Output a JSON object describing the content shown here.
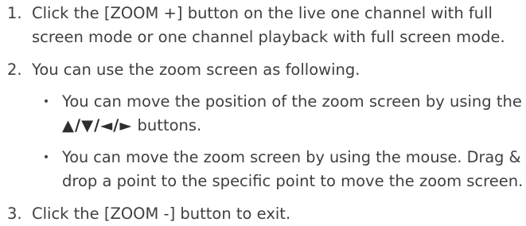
{
  "steps": [
    {
      "number": "1.",
      "lines": [
        "Click the [ZOOM +] button on the live one channel with full",
        "screen mode or one channel playback with full screen mode."
      ]
    },
    {
      "number": "2.",
      "lines": [
        "You can use the zoom screen as following."
      ],
      "bullets": [
        {
          "symbol": "•",
          "lines": [
            "You can move the position of the zoom screen by using the"
          ],
          "arrows": "▲/▼/◄/►",
          "tail": " buttons."
        },
        {
          "symbol": "•",
          "lines": [
            "You can move the zoom screen by using the mouse. Drag &",
            "drop a point to the specific point to move the zoom screen."
          ]
        }
      ]
    },
    {
      "number": "3.",
      "lines": [
        "Click the [ZOOM -] button to exit."
      ]
    }
  ]
}
